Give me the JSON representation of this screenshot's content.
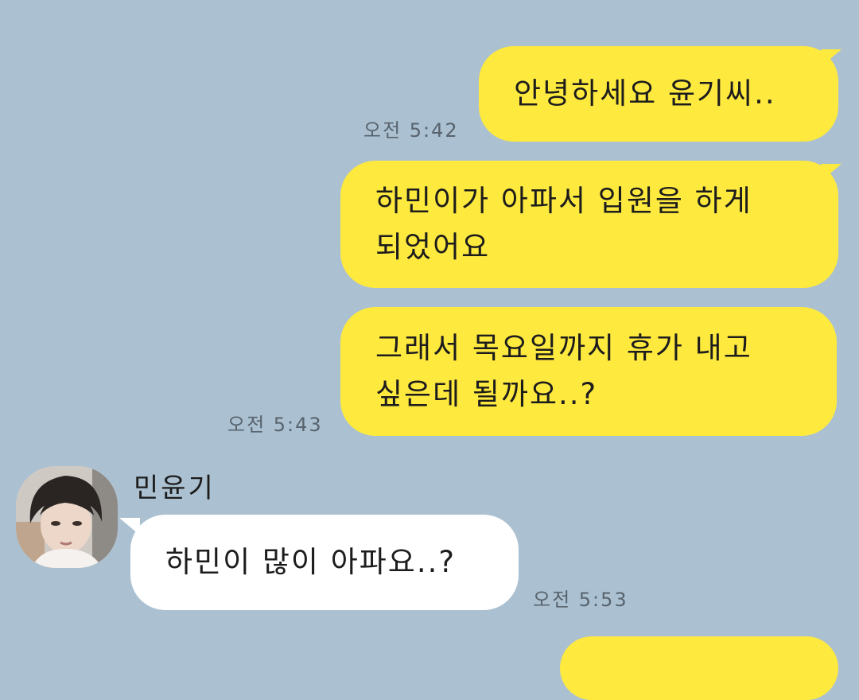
{
  "messages": [
    {
      "id": "m1",
      "side": "me",
      "text": "안녕하세요 윤기씨.."
    },
    {
      "id": "m2",
      "side": "me",
      "text": "하민이가 아파서 입원을 하게\n되었어요"
    },
    {
      "id": "m3",
      "side": "me",
      "text": "그래서 목요일까지 휴가 내고\n싶은데 될까요..?"
    },
    {
      "id": "m4",
      "side": "them",
      "text": "하민이 많이 아파요..?"
    }
  ],
  "timestamps": {
    "t1": "오전 5:42",
    "t2": "오전 5:43",
    "t3": "오전 5:53"
  },
  "contact": {
    "name": "민윤기",
    "avatar_icon": "profile-photo"
  },
  "colors": {
    "background": "#abc1d1",
    "my_bubble": "#fee93f",
    "their_bubble": "#ffffff"
  }
}
